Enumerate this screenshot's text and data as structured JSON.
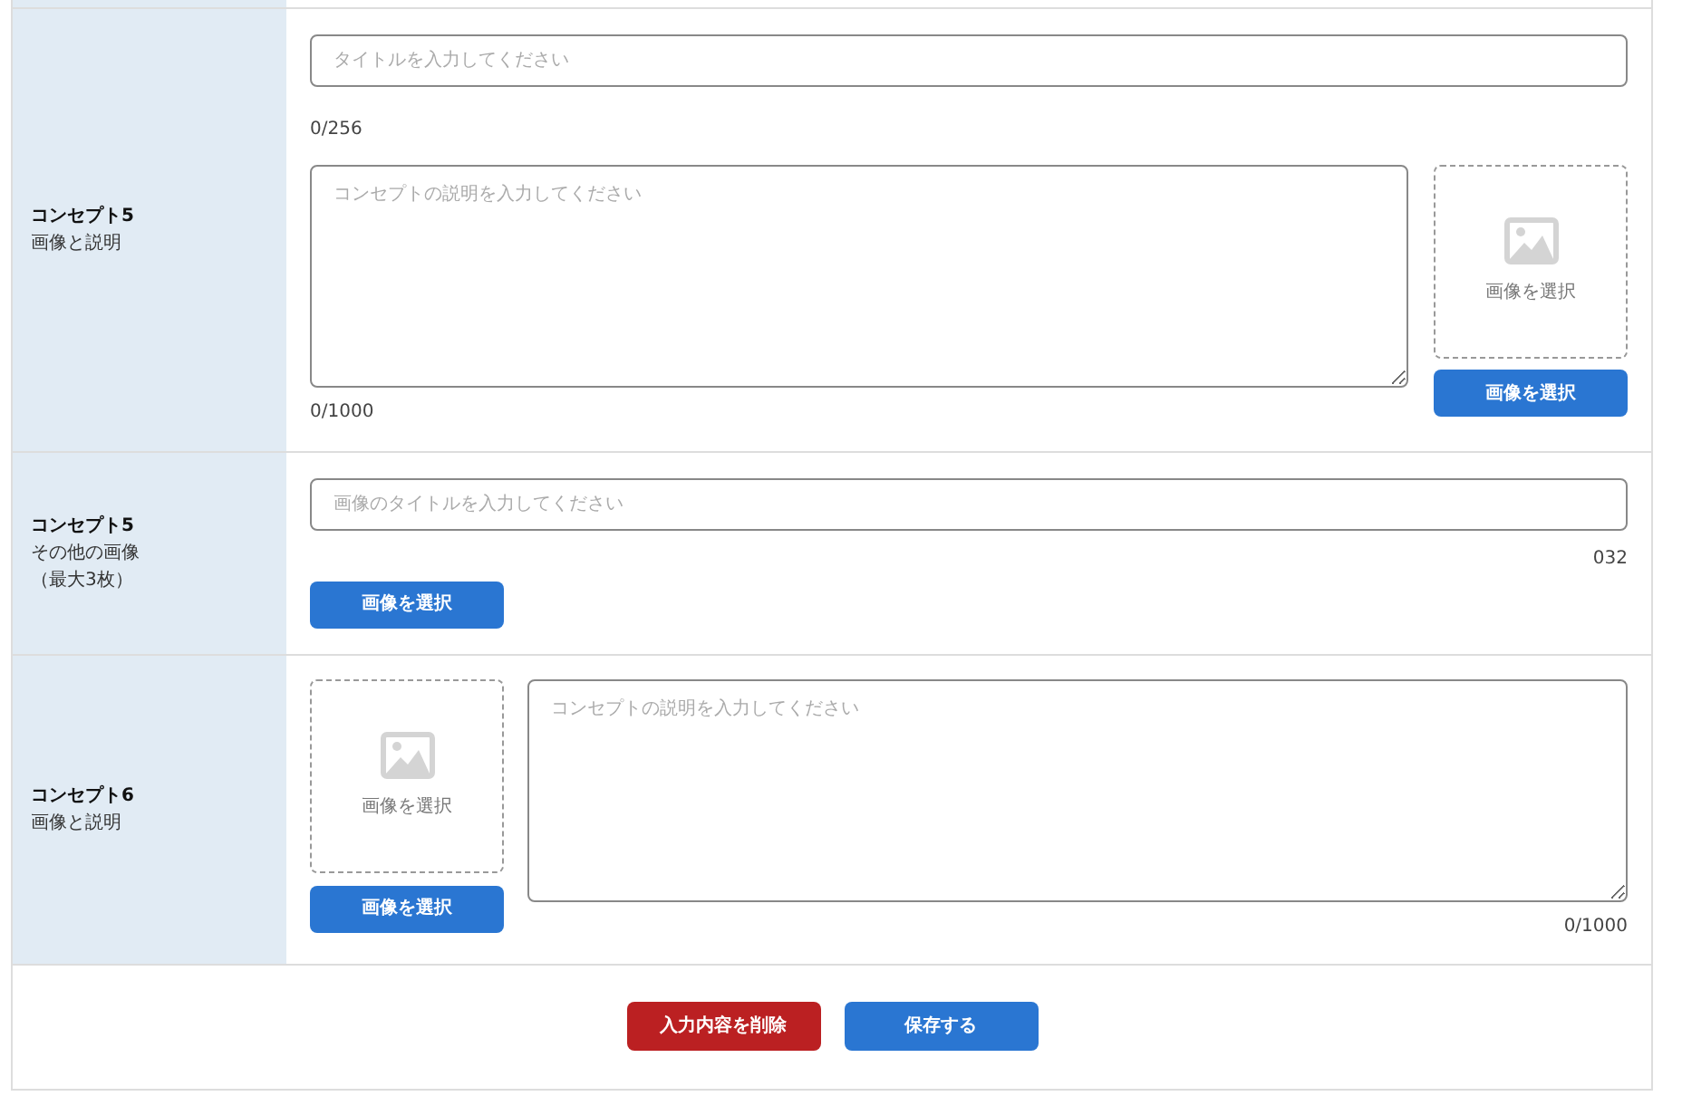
{
  "sections": [
    {
      "kind": "title_desc_image",
      "heading": "コンセプト5",
      "subheading": "画像と説明",
      "title_placeholder": "タイトルを入力してください",
      "title_count": "0/256",
      "desc_placeholder": "コンセプトの説明を入力してください",
      "desc_count": "0/1000",
      "image_label": "画像を選択",
      "button": "画像を選択"
    },
    {
      "kind": "title_images",
      "heading": "コンセプト5",
      "subheading": "その他の画像",
      "note": "（最大3枚）",
      "title_placeholder": "画像のタイトルを入力してください",
      "title_count": "032",
      "button": "画像を選択"
    },
    {
      "kind": "image_desc",
      "heading": "コンセプト6",
      "subheading": "画像と説明",
      "image_label": "画像を選択",
      "button": "画像を選択",
      "desc_placeholder": "コンセプトの説明を入力してください",
      "desc_count": "0/1000"
    }
  ],
  "footer": {
    "delete_button": "入力内容を削除",
    "save_button": "保存する"
  }
}
